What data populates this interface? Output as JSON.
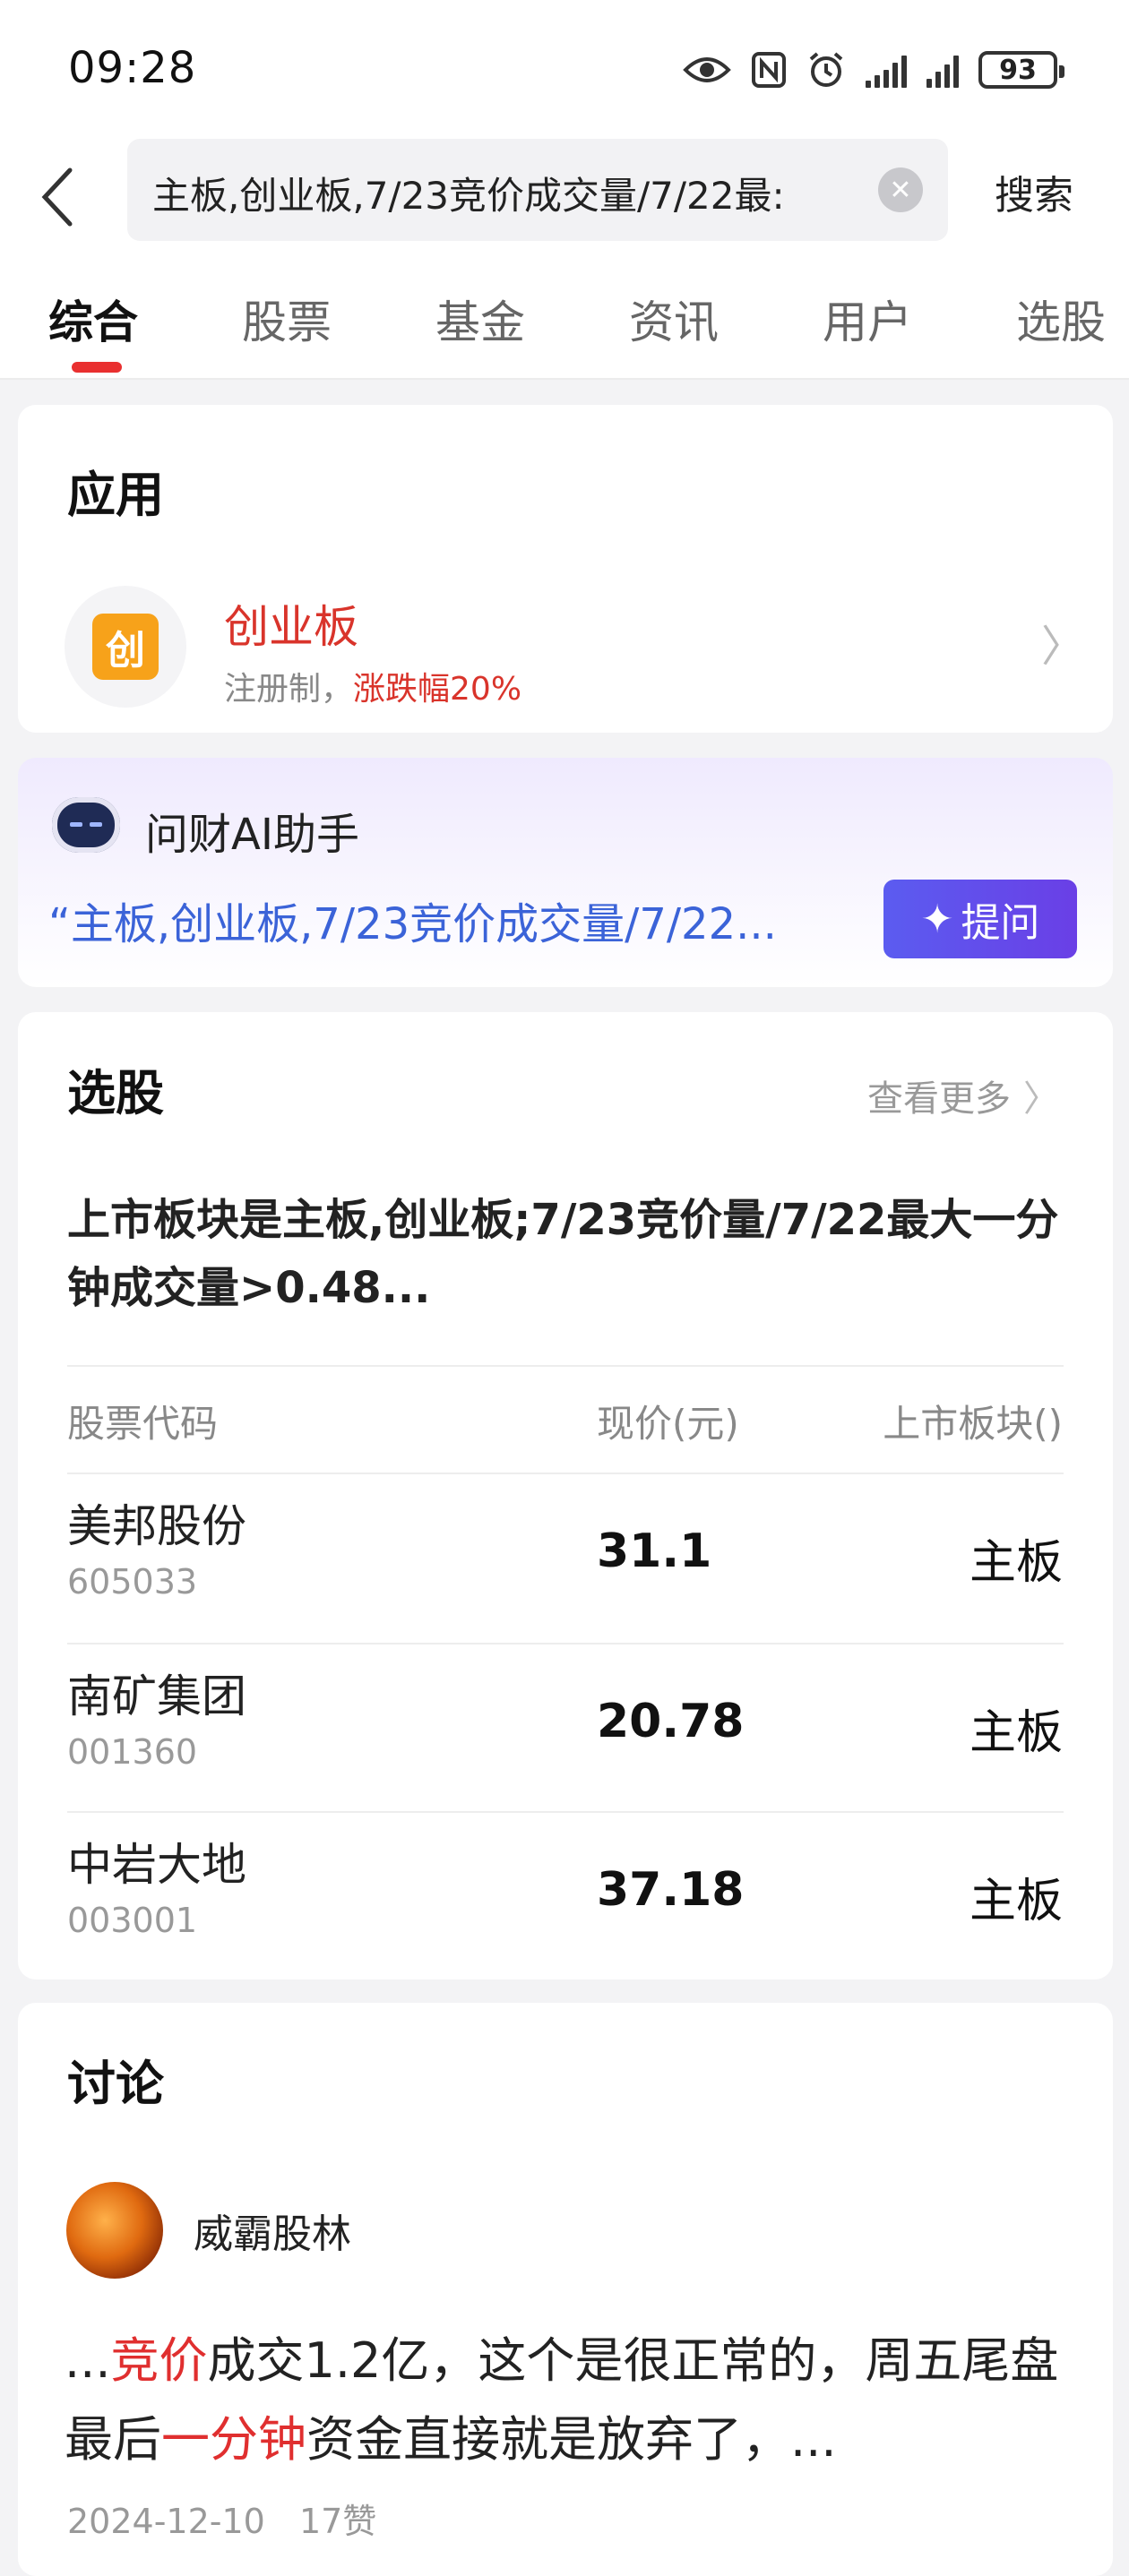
{
  "status_bar": {
    "time": "09:28",
    "battery": "93"
  },
  "search": {
    "query": "主板,创业板,7/23竞价成交量/7/22最:",
    "search_label": "搜索"
  },
  "tabs": [
    {
      "label": "综合",
      "active": true
    },
    {
      "label": "股票"
    },
    {
      "label": "基金"
    },
    {
      "label": "资讯"
    },
    {
      "label": "用户"
    },
    {
      "label": "选股"
    }
  ],
  "app_section": {
    "title": "应用",
    "icon_char": "创",
    "name": "创业板",
    "desc_prefix": "注册制，",
    "desc_highlight": "涨跌幅20%"
  },
  "ai_section": {
    "title": "问财AI助手",
    "query": "“主板,创业板,7/23竞价成交量/7/22...",
    "ask_label": "提问"
  },
  "stock_section": {
    "title": "选股",
    "more_label": "查看更多",
    "query_text": "上市板块是主板,创业板;7/23竞价量/7/22最大一分钟成交量>0.48...",
    "headers": [
      "股票代码",
      "现价(元)",
      "上市板块()"
    ],
    "rows": [
      {
        "name": "美邦股份",
        "code": "605033",
        "price": "31.1",
        "board": "主板"
      },
      {
        "name": "南矿集团",
        "code": "001360",
        "price": "20.78",
        "board": "主板"
      },
      {
        "name": "中岩大地",
        "code": "003001",
        "price": "37.18",
        "board": "主板"
      }
    ]
  },
  "discussion": {
    "title": "讨论",
    "username": "威霸股林",
    "post_parts": [
      "...",
      "竞价",
      "成交1.2亿，这个是很正常的，周五尾盘最后",
      "一分钟",
      "资金直接就是放弃了，..."
    ],
    "date": "2024-12-10",
    "likes": "17赞"
  },
  "colors": {
    "accent_red": "#e93030",
    "link_blue": "#3b63d8",
    "ai_button": "#5b5cf0"
  }
}
